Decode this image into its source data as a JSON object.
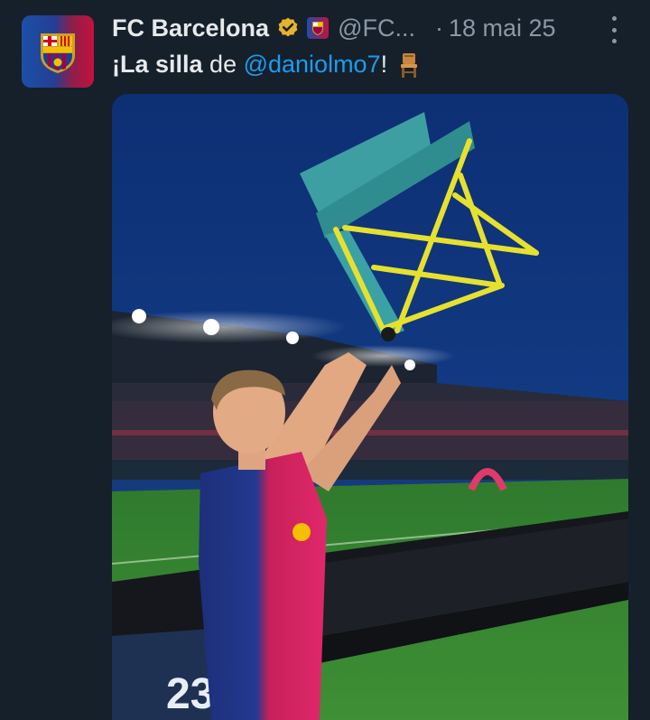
{
  "tweet": {
    "author_name": "FC Barcelona",
    "handle": "@FC...",
    "separator": "·",
    "time": "18 mai 25",
    "text_part1": "¡La silla",
    "text_part2": " de ",
    "mention": "@daniolmo7",
    "text_part3": "!"
  },
  "icons": {
    "verified": "gold-verified-badge",
    "affiliation": "fc-barcelona-crest",
    "more": "more-options-vertical",
    "emoji": "chair-emoji"
  },
  "photo": {
    "jersey_number": "23"
  },
  "colors": {
    "background": "#15202b",
    "mention": "#1d9bf0",
    "muted": "#8b98a5",
    "verified_gold": "#e8b22b"
  }
}
